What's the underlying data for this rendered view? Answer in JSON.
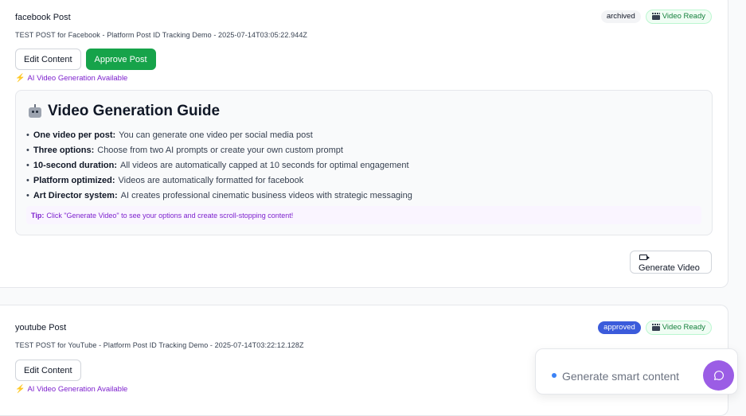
{
  "posts": [
    {
      "title": "facebook Post",
      "subtitle": "TEST POST for Facebook - Platform Post ID Tracking Demo - 2025-07-14T03:05:22.944Z",
      "status_badge": "archived",
      "video_badge": "Video Ready",
      "edit_label": "Edit Content",
      "approve_label": "Approve Post",
      "ai_available": "AI Video Generation Available"
    },
    {
      "title": "youtube Post",
      "subtitle": "TEST POST for YouTube - Platform Post ID Tracking Demo - 2025-07-14T03:22:12.128Z",
      "status_badge": "approved",
      "video_badge": "Video Ready",
      "edit_label": "Edit Content",
      "ai_available": "AI Video Generation Available"
    }
  ],
  "guide": {
    "title": "Video Generation Guide",
    "items": [
      {
        "bold": "One video per post:",
        "text": "You can generate one video per social media post"
      },
      {
        "bold": "Three options:",
        "text": "Choose from two AI prompts or create your own custom prompt"
      },
      {
        "bold": "10-second duration:",
        "text": "All videos are automatically capped at 10 seconds for optimal engagement"
      },
      {
        "bold": "Platform optimized:",
        "text": "Videos are automatically formatted for facebook"
      },
      {
        "bold": "Art Director system:",
        "text": "AI creates professional cinematic business videos with strategic messaging"
      }
    ],
    "tip_label": "Tip:",
    "tip_text": "Click \"Generate Video\" to see your options and create scroll-stopping content!"
  },
  "generate_video_label": "Generate Video",
  "smart_content_label": "Generate smart content",
  "colors": {
    "approve_green": "#16a34a",
    "approved_blue": "#3b5bdb",
    "ai_purple": "#7e22ce",
    "chat_purple": "#9b5de5"
  }
}
